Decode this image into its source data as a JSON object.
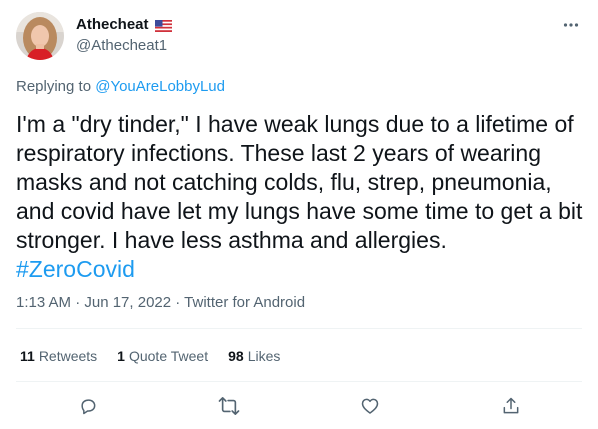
{
  "user": {
    "display_name": "Athecheat",
    "handle": "@Athecheat1",
    "flag_icon": "us-flag-icon"
  },
  "reply": {
    "prefix": "Replying to ",
    "mention": "@YouAreLobbyLud"
  },
  "tweet": {
    "text": "I'm a \"dry tinder,\" I have weak lungs due to a lifetime of respiratory infections. These last 2 years of wearing masks and not catching colds, flu, strep, pneumonia, and covid have let my lungs have some time to get a bit stronger. I have less asthma and allergies.",
    "hashtag": "#ZeroCovid"
  },
  "meta": {
    "datetime": "1:13 AM · Jun 17, 2022",
    "separator": " · ",
    "source": "Twitter for Android"
  },
  "stats": {
    "retweets_count": "11",
    "retweets_label": "Retweets",
    "quotes_count": "1",
    "quotes_label": "Quote Tweet",
    "likes_count": "98",
    "likes_label": "Likes"
  },
  "actions": [
    "reply-icon",
    "retweet-icon",
    "like-icon",
    "share-icon"
  ],
  "colors": {
    "accent": "#1d9bf0",
    "secondary_text": "#536471",
    "primary_text": "#0f1419",
    "divider": "#eff3f4"
  }
}
